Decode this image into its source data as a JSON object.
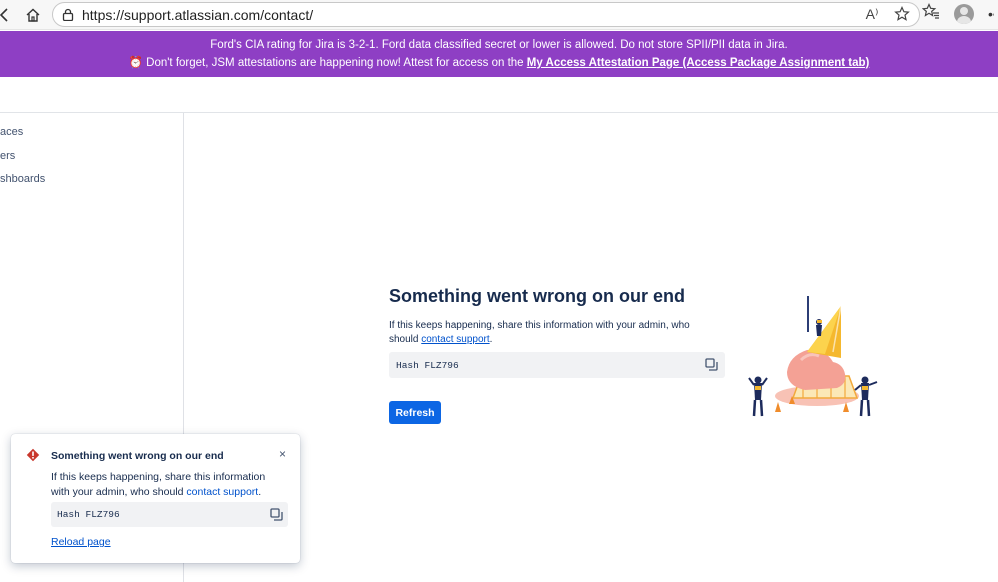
{
  "browser": {
    "url": "https://support.atlassian.com/contact/",
    "back_icon": "back-icon",
    "home_icon": "home-icon",
    "read_aloud_label": "A⁾",
    "favorite_icon": "star-icon",
    "collections_icon": "favorites-icon",
    "more_icon": "more-icon"
  },
  "banner": {
    "line1": "Ford's CIA rating for Jira is 3-2-1. Ford data classified secret or lower is allowed. Do not store SPII/PII data in Jira.",
    "line2_prefix": "⏰ Don't forget, JSM attestations are happening now! Attest for access on the ",
    "line2_link": "My Access Attestation Page (Access Package Assignment tab)",
    "bg_color": "#8e3fc4"
  },
  "sidebar": {
    "items": [
      {
        "label": "aces"
      },
      {
        "label": "ers"
      },
      {
        "label": "shboards"
      }
    ]
  },
  "error": {
    "title": "Something went wrong on our end",
    "desc_prefix": "If this keeps happening, share this information with your admin, who should ",
    "desc_link": "contact support",
    "desc_suffix": ".",
    "hash": "Hash FLZ796",
    "refresh_label": "Refresh",
    "accent": "#0c66e4"
  },
  "toast": {
    "title": "Something went wrong on our end",
    "desc_prefix": "If this keeps happening, share this information with your admin, who should ",
    "desc_link": "contact support",
    "desc_suffix": ".",
    "hash": "Hash FLZ796",
    "reload_label": "Reload page",
    "close_label": "×",
    "icon_color": "#c9372c"
  }
}
